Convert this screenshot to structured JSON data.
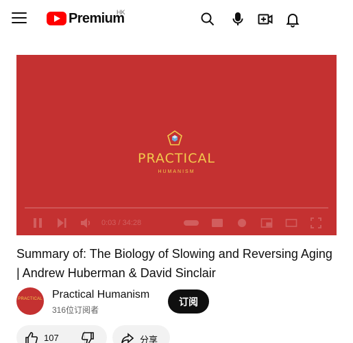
{
  "header": {
    "brand": "Premium",
    "region": "HK",
    "icons": [
      "menu-icon",
      "search-icon",
      "microphone-icon",
      "create-icon",
      "notifications-icon"
    ]
  },
  "player": {
    "brand_name": "PRACTICAL",
    "brand_sub": "HUMANISM",
    "time": "0:03 / 34:28",
    "background_color": "#c43131",
    "accent_color": "#f2c94c"
  },
  "video": {
    "title": "Summary of: The Biology of Slowing and Reversing Aging | Andrew Huberman & David Sinclair"
  },
  "channel": {
    "name": "Practical Humanism",
    "subscribers": "316位订阅者",
    "avatar_text": "PRACTICAL",
    "subscribe_label": "订阅"
  },
  "actions": {
    "likes": "107",
    "share_label": "分享"
  }
}
